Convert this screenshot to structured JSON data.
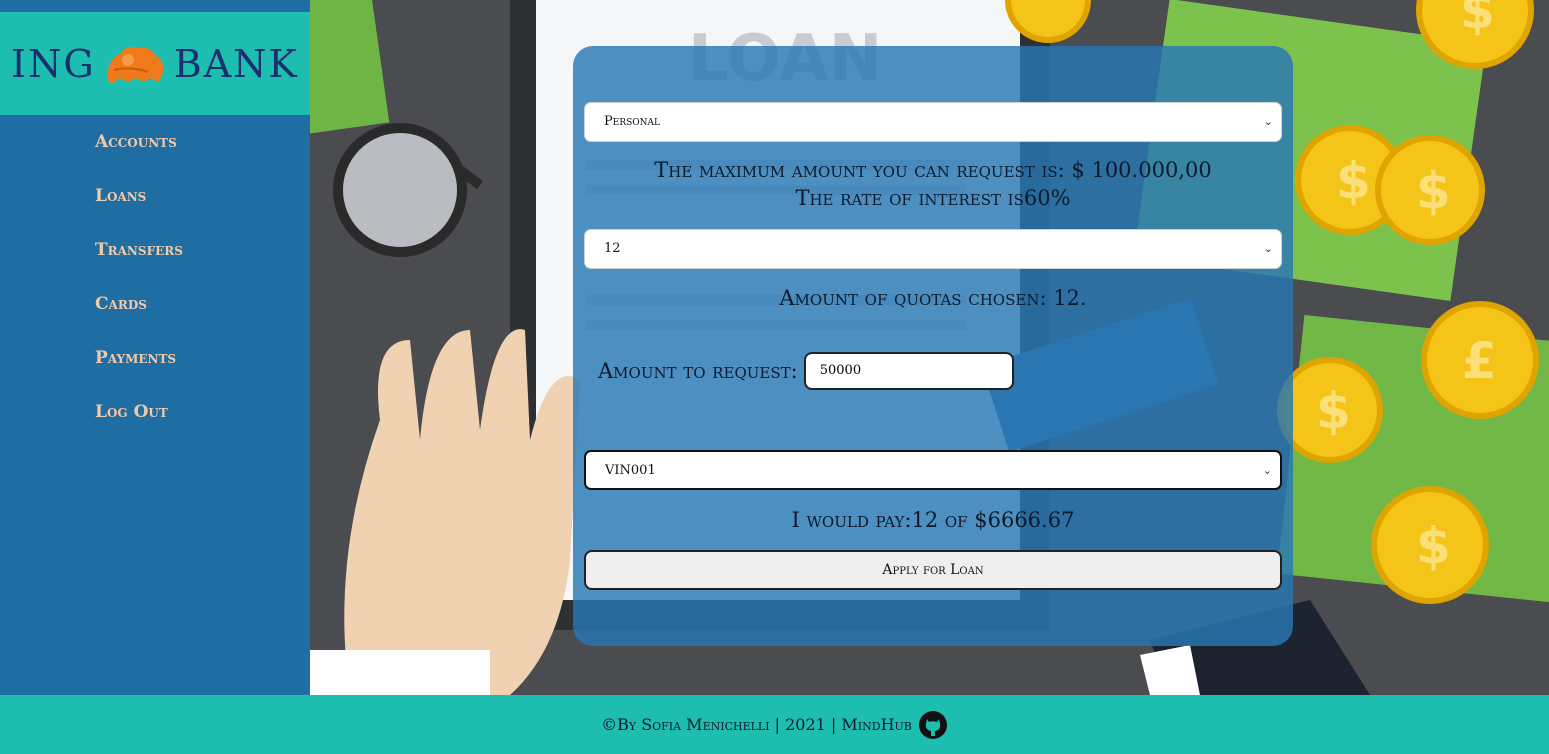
{
  "brand": {
    "left": "ING",
    "right": "BANK",
    "logo_icon": "lion-icon"
  },
  "sidebar": {
    "items": [
      {
        "label": "Accounts"
      },
      {
        "label": "Loans"
      },
      {
        "label": "Transfers"
      },
      {
        "label": "Cards"
      },
      {
        "label": "Payments"
      },
      {
        "label": "Log Out"
      }
    ]
  },
  "form": {
    "loan_type": "Personal",
    "max_amount_text": "The maximum amount you can request is: $ 100.000,00",
    "interest_text": "The rate of interest is60%",
    "quotas_value": "12",
    "quotas_text": "Amount of quotas chosen: 12.",
    "amount_label": "Amount to request:",
    "amount_value": "50000",
    "account_value": "VIN001",
    "pay_text": "I would pay:12 of $6666.67",
    "apply_label": "Apply for Loan"
  },
  "background": {
    "sign_text": "LOAN"
  },
  "footer": {
    "text": "©By Sofia Menichelli | 2021 | MindHub",
    "icon": "github-icon"
  },
  "colors": {
    "sidebar": "#1f6ea3",
    "teal": "#1dbdb0",
    "nav_text": "#f2c9a8",
    "brand_text": "#1a2f6e"
  }
}
